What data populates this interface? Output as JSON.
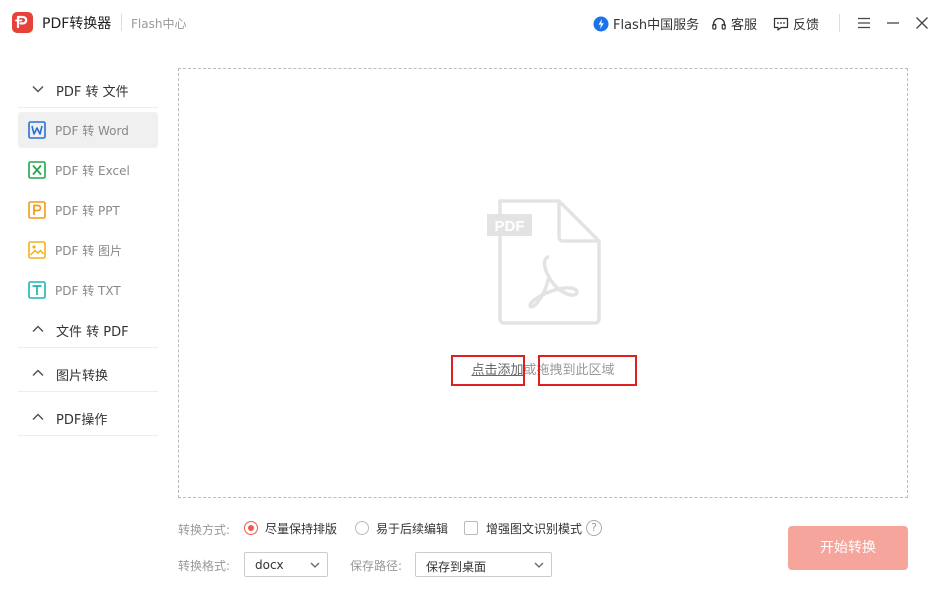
{
  "app": {
    "title": "PDF转换器",
    "subtitle": "Flash中心"
  },
  "header": {
    "service_label": "Flash中国服务",
    "support_label": "客服",
    "feedback_label": "反馈"
  },
  "sidebar": {
    "groups": [
      {
        "label": "PDF 转 文件",
        "expanded": true,
        "items": [
          {
            "label": "PDF 转 Word",
            "icon": "word-icon",
            "color": "#2b6fd6",
            "active": true
          },
          {
            "label": "PDF 转 Excel",
            "icon": "excel-icon",
            "color": "#1fa64a"
          },
          {
            "label": "PDF 转 PPT",
            "icon": "ppt-icon",
            "color": "#f09a1a"
          },
          {
            "label": "PDF 转 图片",
            "icon": "image-icon",
            "color": "#f0b21a"
          },
          {
            "label": "PDF 转 TXT",
            "icon": "txt-icon",
            "color": "#19b5b5"
          }
        ]
      },
      {
        "label": "文件 转 PDF",
        "expanded": false
      },
      {
        "label": "图片转换",
        "expanded": false
      },
      {
        "label": "PDF操作",
        "expanded": false
      }
    ]
  },
  "dropzone": {
    "icon_text": "PDF",
    "add_link": "点击添加",
    "or_text": "或",
    "drag_text": "拖拽到此区域"
  },
  "options": {
    "mode_label": "转换方式:",
    "mode_options": [
      "尽量保持排版",
      "易于后续编辑"
    ],
    "mode_selected": "尽量保持排版",
    "ocr_label": "增强图文识别模式",
    "ocr_checked": false,
    "help_glyph": "?",
    "format_label": "转换格式:",
    "format_value": "docx",
    "path_label": "保存路径:",
    "path_value": "保存到桌面"
  },
  "actions": {
    "start_label": "开始转换"
  },
  "colors": {
    "brand": "#e8413a",
    "accent": "#ef5a4c",
    "start_button": "#f5a59c",
    "highlight_box": "#e02020"
  }
}
